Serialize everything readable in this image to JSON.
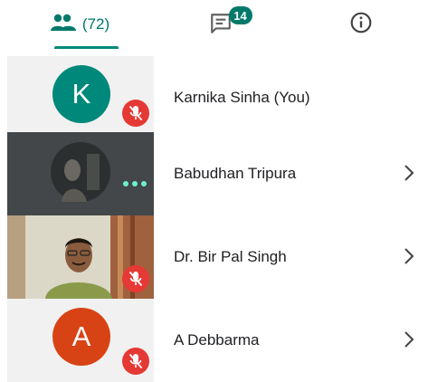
{
  "tabs": {
    "people_count": "(72)",
    "chat_badge": "14"
  },
  "participants": [
    {
      "name": "Karnika Sinha (You)",
      "initial": "K"
    },
    {
      "name": "Babudhan Tripura"
    },
    {
      "name": "Dr. Bir Pal Singh"
    },
    {
      "name": "A Debbarma",
      "initial": "A"
    }
  ],
  "colors": {
    "accent": "#00796b",
    "mic_off": "#e53935",
    "avatar_k": "#00897b",
    "avatar_a": "#d84315",
    "activity_dots": "#6ff0cf"
  },
  "icons": [
    "people-icon",
    "chat-icon",
    "info-icon",
    "mic-off-icon",
    "more-dots-icon",
    "chevron-right-icon"
  ]
}
